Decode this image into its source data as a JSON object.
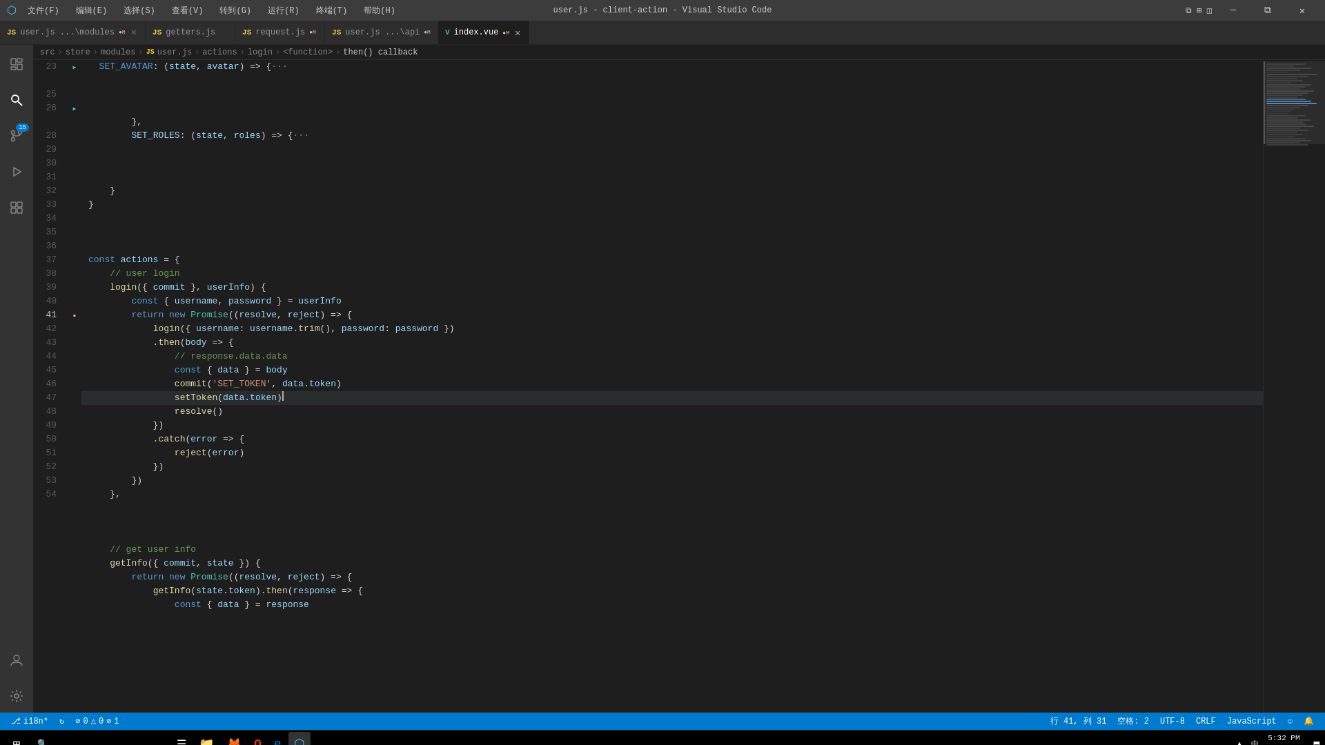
{
  "window": {
    "title": "user.js - client-action - Visual Studio Code"
  },
  "menu": {
    "items": [
      "文件(F)",
      "编辑(E)",
      "选择(S)",
      "查看(V)",
      "转到(G)",
      "运行(R)",
      "终端(T)",
      "帮助(H)"
    ]
  },
  "titlebar": {
    "min": "─",
    "restore": "□",
    "max": "⧉",
    "close": "✕"
  },
  "tabs": [
    {
      "id": "user-modules",
      "icon": "JS",
      "label": "user.js  ...\\modules",
      "modified": "M",
      "active": false,
      "type": "js"
    },
    {
      "id": "getters",
      "icon": "JS",
      "label": "getters.js",
      "modified": "",
      "active": false,
      "type": "js"
    },
    {
      "id": "request",
      "icon": "JS",
      "label": "request.js",
      "modified": "M",
      "active": false,
      "type": "js"
    },
    {
      "id": "user-api",
      "icon": "JS",
      "label": "user.js  ...\\api",
      "modified": "M",
      "active": false,
      "type": "js"
    },
    {
      "id": "index-vue",
      "icon": "V",
      "label": "index.vue",
      "modified": "M",
      "active": true,
      "type": "vue"
    }
  ],
  "breadcrumb": {
    "items": [
      "src",
      "store",
      "modules",
      "user.js",
      "actions",
      "login",
      "<function>",
      "then() callback"
    ]
  },
  "code": {
    "lines": [
      {
        "num": 23,
        "indent": 2,
        "folded": true,
        "content": "SET_AVATAR: (state, avatar) => {···",
        "tokens": [
          {
            "t": "SET_AVATAR",
            "c": "prop"
          },
          {
            "t": ":",
            "c": "punct"
          },
          {
            "t": " (",
            "c": "op"
          },
          {
            "t": "state",
            "c": "var"
          },
          {
            "t": ", ",
            "c": "op"
          },
          {
            "t": "avatar",
            "c": "var"
          },
          {
            "t": ") => {···",
            "c": "op"
          }
        ]
      },
      {
        "num": 25,
        "indent": 2,
        "folded": false,
        "content": "        },",
        "tokens": [
          {
            "t": "        },",
            "c": "op"
          }
        ]
      },
      {
        "num": 26,
        "indent": 2,
        "folded": true,
        "content": "SET_ROLES: (state, roles) => {···",
        "tokens": [
          {
            "t": "SET_ROLES",
            "c": "prop"
          },
          {
            "t": ": (",
            "c": "op"
          },
          {
            "t": "state",
            "c": "var"
          },
          {
            "t": ", ",
            "c": "op"
          },
          {
            "t": "roles",
            "c": "var"
          },
          {
            "t": ") => {···",
            "c": "op"
          }
        ]
      },
      {
        "num": 28,
        "indent": 1,
        "folded": false,
        "content": "    }",
        "tokens": [
          {
            "t": "    }",
            "c": "op"
          }
        ]
      },
      {
        "num": 29,
        "indent": 0,
        "folded": false,
        "content": "}",
        "tokens": [
          {
            "t": "}",
            "c": "op"
          }
        ]
      },
      {
        "num": 30,
        "indent": 0,
        "folded": false,
        "content": "",
        "tokens": []
      },
      {
        "num": 31,
        "indent": 0,
        "folded": false,
        "content": "const actions = {",
        "tokens": [
          {
            "t": "const",
            "c": "kw"
          },
          {
            "t": " actions ",
            "c": "var"
          },
          {
            "t": "= {",
            "c": "op"
          }
        ]
      },
      {
        "num": 32,
        "indent": 1,
        "folded": false,
        "content": "    // user login",
        "tokens": [
          {
            "t": "    ",
            "c": "op"
          },
          {
            "t": "// user login",
            "c": "cmt"
          }
        ]
      },
      {
        "num": 33,
        "indent": 1,
        "folded": false,
        "content": "    login({ commit }, userInfo) {",
        "tokens": [
          {
            "t": "    ",
            "c": "op"
          },
          {
            "t": "login",
            "c": "fn"
          },
          {
            "t": "({ ",
            "c": "op"
          },
          {
            "t": "commit",
            "c": "var"
          },
          {
            "t": " }, ",
            "c": "op"
          },
          {
            "t": "userInfo",
            "c": "var"
          },
          {
            "t": ") {",
            "c": "op"
          }
        ]
      },
      {
        "num": 34,
        "indent": 2,
        "folded": false,
        "content": "        const { username, password } = userInfo",
        "tokens": [
          {
            "t": "        ",
            "c": "op"
          },
          {
            "t": "const",
            "c": "kw"
          },
          {
            "t": " { ",
            "c": "op"
          },
          {
            "t": "username",
            "c": "var"
          },
          {
            "t": ", ",
            "c": "op"
          },
          {
            "t": "password",
            "c": "var"
          },
          {
            "t": " } = ",
            "c": "op"
          },
          {
            "t": "userInfo",
            "c": "var"
          }
        ]
      },
      {
        "num": 35,
        "indent": 2,
        "folded": false,
        "content": "        return new Promise((resolve, reject) => {",
        "tokens": [
          {
            "t": "        ",
            "c": "op"
          },
          {
            "t": "return",
            "c": "kw"
          },
          {
            "t": " ",
            "c": "op"
          },
          {
            "t": "new",
            "c": "kw"
          },
          {
            "t": " ",
            "c": "op"
          },
          {
            "t": "Promise",
            "c": "type"
          },
          {
            "t": "((",
            "c": "op"
          },
          {
            "t": "resolve",
            "c": "var"
          },
          {
            "t": ", ",
            "c": "op"
          },
          {
            "t": "reject",
            "c": "var"
          },
          {
            "t": ") => {",
            "c": "op"
          }
        ]
      },
      {
        "num": 36,
        "indent": 3,
        "folded": false,
        "content": "            login({ username: username.trim(), password: password })",
        "tokens": [
          {
            "t": "            ",
            "c": "op"
          },
          {
            "t": "login",
            "c": "fn"
          },
          {
            "t": "({ ",
            "c": "op"
          },
          {
            "t": "username",
            "c": "var"
          },
          {
            "t": ": ",
            "c": "op"
          },
          {
            "t": "username",
            "c": "var"
          },
          {
            "t": ".",
            "c": "op"
          },
          {
            "t": "trim",
            "c": "fn"
          },
          {
            "t": "(), ",
            "c": "op"
          },
          {
            "t": "password",
            "c": "var"
          },
          {
            "t": ": ",
            "c": "op"
          },
          {
            "t": "password",
            "c": "var"
          },
          {
            "t": " })",
            "c": "op"
          }
        ]
      },
      {
        "num": 37,
        "indent": 3,
        "folded": false,
        "content": "            .then(body => {",
        "tokens": [
          {
            "t": "            ",
            "c": "op"
          },
          {
            "t": ".",
            "c": "op"
          },
          {
            "t": "then",
            "c": "fn"
          },
          {
            "t": "(",
            "c": "op"
          },
          {
            "t": "body",
            "c": "var"
          },
          {
            "t": " => {",
            "c": "op"
          }
        ]
      },
      {
        "num": 38,
        "indent": 4,
        "folded": false,
        "content": "                // response.data.data",
        "tokens": [
          {
            "t": "                ",
            "c": "op"
          },
          {
            "t": "// response.data.data",
            "c": "cmt"
          }
        ]
      },
      {
        "num": 39,
        "indent": 4,
        "folded": false,
        "content": "                const { data } = body",
        "tokens": [
          {
            "t": "                ",
            "c": "op"
          },
          {
            "t": "const",
            "c": "kw"
          },
          {
            "t": " { ",
            "c": "op"
          },
          {
            "t": "data",
            "c": "var"
          },
          {
            "t": " } = ",
            "c": "op"
          },
          {
            "t": "body",
            "c": "var"
          }
        ]
      },
      {
        "num": 40,
        "indent": 4,
        "folded": false,
        "content": "                commit('SET_TOKEN', data.token)",
        "tokens": [
          {
            "t": "                ",
            "c": "op"
          },
          {
            "t": "commit",
            "c": "fn"
          },
          {
            "t": "(",
            "c": "op"
          },
          {
            "t": "'SET_TOKEN'",
            "c": "str"
          },
          {
            "t": ", ",
            "c": "op"
          },
          {
            "t": "data",
            "c": "var"
          },
          {
            "t": ".",
            "c": "op"
          },
          {
            "t": "token",
            "c": "prop"
          },
          {
            "t": ")",
            "c": "op"
          }
        ]
      },
      {
        "num": 41,
        "indent": 4,
        "folded": false,
        "content": "                setToken(data.token)",
        "active": true,
        "tokens": [
          {
            "t": "                ",
            "c": "op"
          },
          {
            "t": "setToken",
            "c": "fn"
          },
          {
            "t": "(",
            "c": "op"
          },
          {
            "t": "data",
            "c": "var"
          },
          {
            "t": ".",
            "c": "op"
          },
          {
            "t": "token",
            "c": "prop"
          },
          {
            "t": ")",
            "c": "op"
          }
        ]
      },
      {
        "num": 42,
        "indent": 4,
        "folded": false,
        "content": "                resolve()",
        "tokens": [
          {
            "t": "                ",
            "c": "op"
          },
          {
            "t": "resolve",
            "c": "fn"
          },
          {
            "t": "()",
            "c": "op"
          }
        ]
      },
      {
        "num": 43,
        "indent": 3,
        "folded": false,
        "content": "            })",
        "tokens": [
          {
            "t": "            })",
            "c": "op"
          }
        ]
      },
      {
        "num": 44,
        "indent": 3,
        "folded": false,
        "content": "            .catch(error => {",
        "tokens": [
          {
            "t": "            .",
            "c": "op"
          },
          {
            "t": "catch",
            "c": "fn"
          },
          {
            "t": "(",
            "c": "op"
          },
          {
            "t": "error",
            "c": "var"
          },
          {
            "t": " => {",
            "c": "op"
          }
        ]
      },
      {
        "num": 45,
        "indent": 4,
        "folded": false,
        "content": "                reject(error)",
        "tokens": [
          {
            "t": "                ",
            "c": "op"
          },
          {
            "t": "reject",
            "c": "fn"
          },
          {
            "t": "(",
            "c": "op"
          },
          {
            "t": "error",
            "c": "var"
          },
          {
            "t": ")",
            "c": "op"
          }
        ]
      },
      {
        "num": 46,
        "indent": 3,
        "folded": false,
        "content": "            })",
        "tokens": [
          {
            "t": "            })",
            "c": "op"
          }
        ]
      },
      {
        "num": 47,
        "indent": 2,
        "folded": false,
        "content": "        })",
        "tokens": [
          {
            "t": "        })",
            "c": "op"
          }
        ]
      },
      {
        "num": 48,
        "indent": 1,
        "folded": false,
        "content": "    },",
        "tokens": [
          {
            "t": "    },",
            "c": "op"
          }
        ]
      },
      {
        "num": 49,
        "indent": 0,
        "folded": false,
        "content": "",
        "tokens": []
      },
      {
        "num": 50,
        "indent": 1,
        "folded": false,
        "content": "    // get user info",
        "tokens": [
          {
            "t": "    ",
            "c": "op"
          },
          {
            "t": "// get user info",
            "c": "cmt"
          }
        ]
      },
      {
        "num": 51,
        "indent": 1,
        "folded": false,
        "content": "    getInfo({ commit, state }) {",
        "tokens": [
          {
            "t": "    ",
            "c": "op"
          },
          {
            "t": "getInfo",
            "c": "fn"
          },
          {
            "t": "({ ",
            "c": "op"
          },
          {
            "t": "commit",
            "c": "var"
          },
          {
            "t": ", ",
            "c": "op"
          },
          {
            "t": "state",
            "c": "var"
          },
          {
            "t": " }) {",
            "c": "op"
          }
        ]
      },
      {
        "num": 52,
        "indent": 2,
        "folded": false,
        "content": "        return new Promise((resolve, reject) => {",
        "tokens": [
          {
            "t": "        ",
            "c": "op"
          },
          {
            "t": "return",
            "c": "kw"
          },
          {
            "t": " ",
            "c": "op"
          },
          {
            "t": "new",
            "c": "kw"
          },
          {
            "t": " ",
            "c": "op"
          },
          {
            "t": "Promise",
            "c": "type"
          },
          {
            "t": "((",
            "c": "op"
          },
          {
            "t": "resolve",
            "c": "var"
          },
          {
            "t": ", ",
            "c": "op"
          },
          {
            "t": "reject",
            "c": "var"
          },
          {
            "t": ") => {",
            "c": "op"
          }
        ]
      },
      {
        "num": 53,
        "indent": 3,
        "folded": false,
        "content": "            getInfo(state.token).then(response => {",
        "tokens": [
          {
            "t": "            ",
            "c": "op"
          },
          {
            "t": "getInfo",
            "c": "fn"
          },
          {
            "t": "(",
            "c": "op"
          },
          {
            "t": "state",
            "c": "var"
          },
          {
            "t": ".",
            "c": "op"
          },
          {
            "t": "token",
            "c": "prop"
          },
          {
            "t": ").",
            "c": "op"
          },
          {
            "t": "then",
            "c": "fn"
          },
          {
            "t": "(",
            "c": "op"
          },
          {
            "t": "response",
            "c": "var"
          },
          {
            "t": " => {",
            "c": "op"
          }
        ]
      },
      {
        "num": 54,
        "indent": 4,
        "folded": false,
        "content": "                const { data } = response",
        "tokens": [
          {
            "t": "                ",
            "c": "op"
          },
          {
            "t": "const",
            "c": "kw"
          },
          {
            "t": " { ",
            "c": "op"
          },
          {
            "t": "data",
            "c": "var"
          },
          {
            "t": " } = ",
            "c": "op"
          },
          {
            "t": "response",
            "c": "var"
          }
        ]
      }
    ]
  },
  "status_bar": {
    "left": [
      {
        "id": "branch",
        "icon": "⎇",
        "text": "i18n*"
      },
      {
        "id": "sync",
        "icon": "↻",
        "text": ""
      },
      {
        "id": "errors",
        "icon": "⊘",
        "text": "0 △ 0 ⊘ 1"
      }
    ],
    "right": [
      {
        "id": "cursor",
        "text": "行 41, 列 31"
      },
      {
        "id": "spaces",
        "text": "空格: 2"
      },
      {
        "id": "encoding",
        "text": "UTF-8"
      },
      {
        "id": "eol",
        "text": "CRLF"
      },
      {
        "id": "language",
        "text": "JavaScript"
      },
      {
        "id": "smiley",
        "text": "☺"
      },
      {
        "id": "bell",
        "text": "🔔"
      }
    ]
  },
  "taskbar": {
    "start_label": "⊞",
    "apps": [
      {
        "id": "search-app",
        "icon": "🔍"
      },
      {
        "id": "task-view",
        "icon": "☰"
      },
      {
        "id": "edge",
        "icon": "e"
      },
      {
        "id": "explorer",
        "icon": "📁"
      },
      {
        "id": "firefox",
        "icon": "🦊"
      },
      {
        "id": "office",
        "icon": "O"
      },
      {
        "id": "ie",
        "icon": "e"
      },
      {
        "id": "vscode",
        "icon": "⬡"
      }
    ],
    "time": "▲  中  5:32 PM",
    "layout_icon": "⬒"
  },
  "activity_bar": {
    "items": [
      {
        "id": "explorer",
        "icon": "📋",
        "unicode": "⎘",
        "active": false
      },
      {
        "id": "search",
        "icon": "🔍",
        "unicode": "⌕",
        "active": true
      },
      {
        "id": "source-control",
        "icon": "🔀",
        "unicode": "⑂",
        "active": false,
        "badge": "15"
      },
      {
        "id": "debug",
        "icon": "▶",
        "unicode": "▶",
        "active": false
      },
      {
        "id": "extensions",
        "icon": "⬛",
        "unicode": "⊞",
        "active": false
      },
      {
        "id": "accounts",
        "icon": "👤",
        "unicode": "◯",
        "active": false,
        "bottom": true
      },
      {
        "id": "settings",
        "icon": "⚙",
        "unicode": "⚙",
        "active": false,
        "bottom": true
      }
    ]
  }
}
